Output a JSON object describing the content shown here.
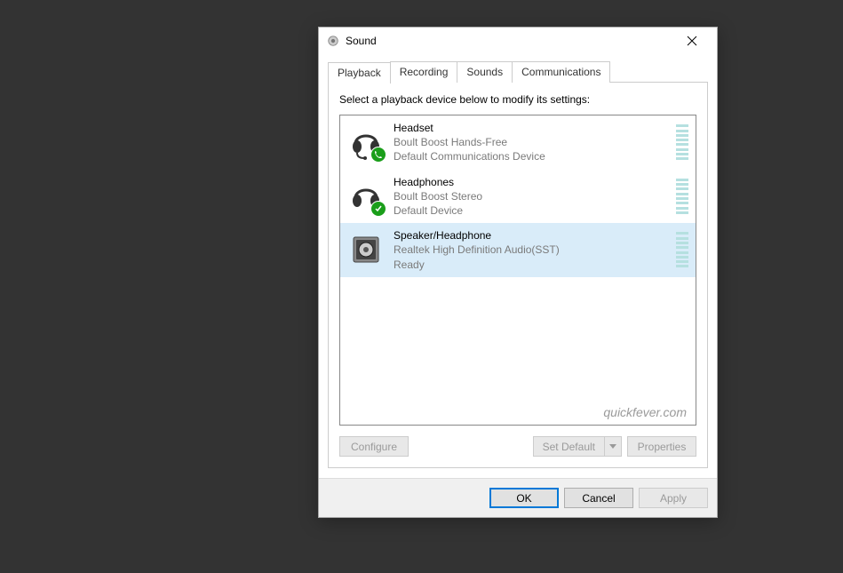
{
  "window": {
    "title": "Sound"
  },
  "tabs": [
    {
      "label": "Playback",
      "active": true
    },
    {
      "label": "Recording",
      "active": false
    },
    {
      "label": "Sounds",
      "active": false
    },
    {
      "label": "Communications",
      "active": false
    }
  ],
  "instruction": "Select a playback device below to modify its settings:",
  "devices": [
    {
      "name": "Headset",
      "desc": "Boult Boost Hands-Free",
      "status": "Default Communications Device",
      "icon": "headset",
      "badge": "phone",
      "selected": false
    },
    {
      "name": "Headphones",
      "desc": "Boult Boost Stereo",
      "status": "Default Device",
      "icon": "headphones",
      "badge": "check",
      "selected": false
    },
    {
      "name": "Speaker/Headphone",
      "desc": "Realtek High Definition Audio(SST)",
      "status": "Ready",
      "icon": "speaker",
      "badge": null,
      "selected": true
    }
  ],
  "watermark": "quickfever.com",
  "buttons": {
    "configure": "Configure",
    "setDefault": "Set Default",
    "properties": "Properties",
    "ok": "OK",
    "cancel": "Cancel",
    "apply": "Apply"
  }
}
